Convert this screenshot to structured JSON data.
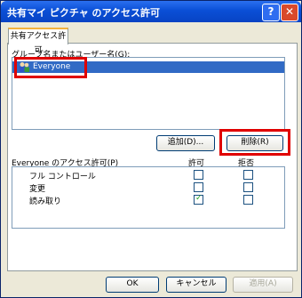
{
  "window": {
    "title": "共有マイ ピクチャ のアクセス許可",
    "help": "?",
    "close": "✕"
  },
  "tabs": [
    {
      "label": "共有アクセス許可"
    }
  ],
  "groups": {
    "label": "グループ名またはユーザー名(G):",
    "items": [
      {
        "name": "Everyone",
        "selected": true,
        "icon": "users-icon"
      }
    ]
  },
  "buttons": {
    "add": "追加(D)...",
    "remove": "削除(R)"
  },
  "permissions": {
    "header": "Everyone のアクセス許可(P)",
    "allow_label": "許可",
    "deny_label": "拒否",
    "rows": [
      {
        "name": "フル コントロール",
        "allow": false,
        "deny": false
      },
      {
        "name": "変更",
        "allow": false,
        "deny": false
      },
      {
        "name": "読み取り",
        "allow": true,
        "deny": false
      }
    ]
  },
  "footer": {
    "ok": "OK",
    "cancel": "キャンセル",
    "apply": "適用(A)"
  },
  "colors": {
    "accent": "#316ac5",
    "highlight": "#e00000"
  }
}
